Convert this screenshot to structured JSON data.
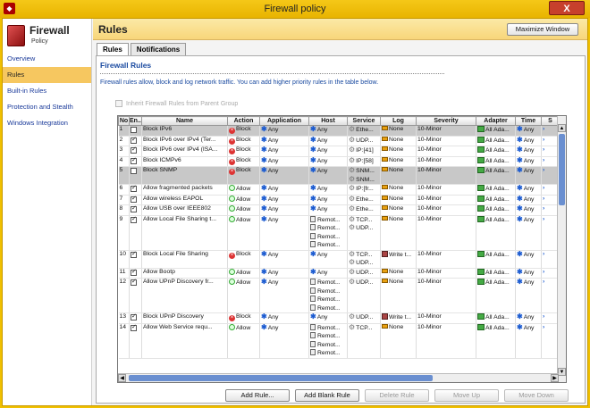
{
  "window": {
    "title": "Firewall policy",
    "close_label": "X",
    "app_icon": "shield-icon"
  },
  "sidebar": {
    "logo_title": "Firewall",
    "logo_sub": "Policy",
    "items": [
      {
        "label": "Overview",
        "active": false
      },
      {
        "label": "Rules",
        "active": true
      },
      {
        "label": "Built-in Rules",
        "active": false
      },
      {
        "label": "Protection and Stealth",
        "active": false
      },
      {
        "label": "Windows Integration",
        "active": false
      }
    ]
  },
  "header": {
    "title": "Rules",
    "maximize_label": "Maximize Window"
  },
  "tabs": [
    {
      "label": "Rules",
      "active": true
    },
    {
      "label": "Notifications",
      "active": false
    }
  ],
  "panel": {
    "section_title": "Firewall Rules",
    "description": "Firewall rules allow, block and log network traffic. You can add higher priority rules in the table below.",
    "inherit_label": "Inherit Firewall Rules from Parent Group"
  },
  "table": {
    "columns": [
      "No",
      "En...",
      "Name",
      "Action",
      "Application",
      "Host",
      "Service",
      "Log",
      "Severity",
      "Adapter",
      "Time",
      "S"
    ],
    "rows": [
      {
        "no": "1",
        "enabled": false,
        "name": "Block IPv6",
        "action": "Block",
        "application": "Any",
        "host": [
          "Any"
        ],
        "service": [
          "Ethe..."
        ],
        "log": "None",
        "log_type": "none",
        "severity": "10-Minor",
        "adapter": "All Ada...",
        "time": "Any",
        "selected": true
      },
      {
        "no": "2",
        "enabled": true,
        "name": "Block IPv6 over IPv4 (Ter...",
        "action": "Block",
        "application": "Any",
        "host": [
          "Any"
        ],
        "service": [
          "UDP..."
        ],
        "log": "None",
        "log_type": "none",
        "severity": "10-Minor",
        "adapter": "All Ada...",
        "time": "Any",
        "selected": false
      },
      {
        "no": "3",
        "enabled": true,
        "name": "Block IPv6 over IPv4 (ISA...",
        "action": "Block",
        "application": "Any",
        "host": [
          "Any"
        ],
        "service": [
          "IP:[41]"
        ],
        "log": "None",
        "log_type": "none",
        "severity": "10-Minor",
        "adapter": "All Ada...",
        "time": "Any",
        "selected": false
      },
      {
        "no": "4",
        "enabled": true,
        "name": "Block ICMPv6",
        "action": "Block",
        "application": "Any",
        "host": [
          "Any"
        ],
        "service": [
          "IP:[58]"
        ],
        "log": "None",
        "log_type": "none",
        "severity": "10-Minor",
        "adapter": "All Ada...",
        "time": "Any",
        "selected": false
      },
      {
        "no": "5",
        "enabled": false,
        "name": "Block SNMP",
        "action": "Block",
        "application": "Any",
        "host": [
          "Any"
        ],
        "service": [
          "SNM...",
          "SNM..."
        ],
        "log": "None",
        "log_type": "none",
        "severity": "10-Minor",
        "adapter": "All Ada...",
        "time": "Any",
        "selected": true
      },
      {
        "no": "6",
        "enabled": true,
        "name": "Allow fragmented packets",
        "action": "Allow",
        "application": "Any",
        "host": [
          "Any"
        ],
        "service": [
          "IP:[fr..."
        ],
        "log": "None",
        "log_type": "none",
        "severity": "10-Minor",
        "adapter": "All Ada...",
        "time": "Any",
        "selected": false
      },
      {
        "no": "7",
        "enabled": true,
        "name": "Allow wireless EAPOL",
        "action": "Allow",
        "application": "Any",
        "host": [
          "Any"
        ],
        "service": [
          "Ethe..."
        ],
        "log": "None",
        "log_type": "none",
        "severity": "10-Minor",
        "adapter": "All Ada...",
        "time": "Any",
        "selected": false
      },
      {
        "no": "8",
        "enabled": true,
        "name": "Allow USB over IEEE802",
        "action": "Allow",
        "application": "Any",
        "host": [
          "Any"
        ],
        "service": [
          "Ethe..."
        ],
        "log": "None",
        "log_type": "none",
        "severity": "10-Minor",
        "adapter": "All Ada...",
        "time": "Any",
        "selected": false
      },
      {
        "no": "9",
        "enabled": true,
        "name": "Allow Local File Sharing t...",
        "action": "Allow",
        "application": "Any",
        "host": [
          "Remot...",
          "Remot...",
          "Remot...",
          "Remot..."
        ],
        "service": [
          "TCP...",
          "UDP..."
        ],
        "log": "None",
        "log_type": "none",
        "severity": "10-Minor",
        "adapter": "All Ada...",
        "time": "Any",
        "selected": false
      },
      {
        "no": "10",
        "enabled": true,
        "name": "Block Local File Sharing",
        "action": "Block",
        "application": "Any",
        "host": [
          "Any"
        ],
        "service": [
          "TCP...",
          "UDP..."
        ],
        "log": "Write t...",
        "log_type": "write",
        "severity": "10-Minor",
        "adapter": "All Ada...",
        "time": "Any",
        "selected": false
      },
      {
        "no": "11",
        "enabled": true,
        "name": "Allow Bootp",
        "action": "Allow",
        "application": "Any",
        "host": [
          "Any"
        ],
        "service": [
          "UDP..."
        ],
        "log": "None",
        "log_type": "none",
        "severity": "10-Minor",
        "adapter": "All Ada...",
        "time": "Any",
        "selected": false
      },
      {
        "no": "12",
        "enabled": true,
        "name": "Allow UPnP Discovery fr...",
        "action": "Allow",
        "application": "Any",
        "host": [
          "Remot...",
          "Remot...",
          "Remot...",
          "Remot..."
        ],
        "service": [
          "UDP..."
        ],
        "log": "None",
        "log_type": "none",
        "severity": "10-Minor",
        "adapter": "All Ada...",
        "time": "Any",
        "selected": false
      },
      {
        "no": "13",
        "enabled": true,
        "name": "Block UPnP Discovery",
        "action": "Block",
        "application": "Any",
        "host": [
          "Any"
        ],
        "service": [
          "UDP..."
        ],
        "log": "Write t...",
        "log_type": "write",
        "severity": "10-Minor",
        "adapter": "All Ada...",
        "time": "Any",
        "selected": false
      },
      {
        "no": "14",
        "enabled": true,
        "name": "Allow Web Service requ...",
        "action": "Allow",
        "application": "Any",
        "host": [
          "Remot...",
          "Remot...",
          "Remot...",
          "Remot..."
        ],
        "service": [
          "TCP..."
        ],
        "log": "None",
        "log_type": "none",
        "severity": "10-Minor",
        "adapter": "All Ada...",
        "time": "Any",
        "selected": false
      }
    ]
  },
  "buttons": {
    "add_rule": "Add Rule...",
    "add_blank_rule": "Add Blank Rule",
    "delete_rule": "Delete Rule",
    "move_up": "Move Up",
    "move_down": "Move Down"
  },
  "colors": {
    "accent": "#f0c000",
    "link": "#1a4aa0",
    "nav_active": "#f6c760"
  }
}
